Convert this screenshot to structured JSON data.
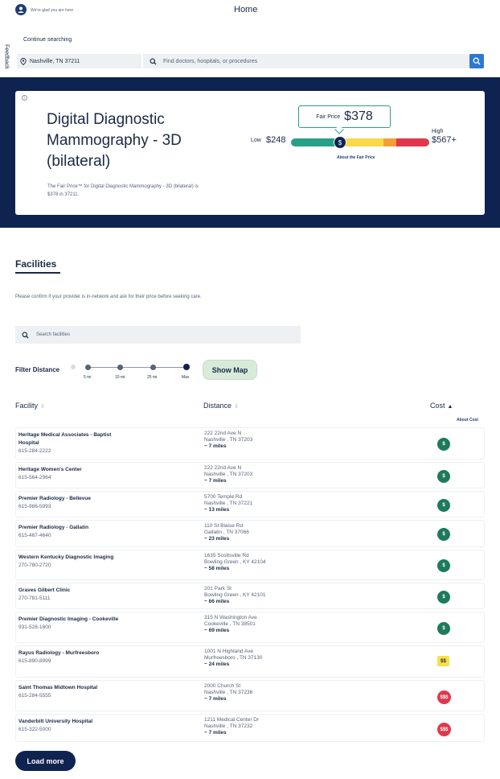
{
  "header": {
    "greeting": "We're glad you are here",
    "title": "Home",
    "continue_label": "Continue searching",
    "location_value": "Nashville, TN 37211",
    "search_placeholder": "Find doctors, hospitals, or procedures",
    "feedback_label": "Feedback"
  },
  "procedure": {
    "title": "Digital Diagnostic Mammography - 3D (bilateral)",
    "description": "The Fair Price™ for Digital Diagnostic Mammography - 3D (bilateral) is $378 in 37211.",
    "fair_price_label": "Fair Price",
    "fair_price_value": "$378",
    "low_label": "Low",
    "low_value": "$248",
    "high_label": "High",
    "high_value": "$567+",
    "marker_symbol": "$",
    "about_link": "About the Fair Price"
  },
  "facilities": {
    "heading": "Facilities",
    "note": "Please confirm if your provider is in-network and ask for their price before seeking care.",
    "search_placeholder": "Search facilities",
    "filter_label": "Filter Distance",
    "distance_options": [
      "5 mi",
      "10 mi",
      "25 mi",
      "Max"
    ],
    "distance_selected_index": 3,
    "show_map_label": "Show Map",
    "columns": {
      "facility": "Facility",
      "distance": "Distance",
      "cost": "Cost"
    },
    "about_cost": "About Cost",
    "rows": [
      {
        "name": "Heritage Medical Associates - Baptist Hospital",
        "phone": "615-284-2222",
        "addr1": "222 22nd Ave N",
        "addr2": "Nashville , TN 37203",
        "distance": "~ 7 miles",
        "cost": "$"
      },
      {
        "name": "Heritage Women's Center",
        "phone": "615-564-2964",
        "addr1": "222 22nd Ave N",
        "addr2": "Nashville , TN 37203",
        "distance": "~ 7 miles",
        "cost": "$"
      },
      {
        "name": "Premier Radiology - Bellevue",
        "phone": "615-986-5993",
        "addr1": "5700 Temple Rd",
        "addr2": "Nashville , TN 37221",
        "distance": "~ 13 miles",
        "cost": "$"
      },
      {
        "name": "Premier Radiology - Gallatin",
        "phone": "615-467-4640",
        "addr1": "110 St Blaise Rd",
        "addr2": "Gallatin , TN 37066",
        "distance": "~ 23 miles",
        "cost": "$"
      },
      {
        "name": "Western Kentucky Diagnostic Imaging",
        "phone": "270-780-2720",
        "addr1": "1635 Scottsville Rd",
        "addr2": "Bowling Green , KY 42104",
        "distance": "~ 58 miles",
        "cost": "$"
      },
      {
        "name": "Graves Gilbert Clinic",
        "phone": "270-781-5111",
        "addr1": "201 Park St",
        "addr2": "Bowling Green , KY 42101",
        "distance": "~ 66 miles",
        "cost": "$"
      },
      {
        "name": "Premier Diagnostic Imaging - Cookeville",
        "phone": "931-528-1800",
        "addr1": "315 N Washington Ave",
        "addr2": "Cookeville , TN 38501",
        "distance": "~ 69 miles",
        "cost": "$"
      },
      {
        "name": "Rayus Radiology - Murfreesboro",
        "phone": "615-890-8999",
        "addr1": "1001 N Highland Ave",
        "addr2": "Murfreesboro , TN 37130",
        "distance": "~ 24 miles",
        "cost": "$$"
      },
      {
        "name": "Saint Thomas Midtown Hospital",
        "phone": "615-284-5555",
        "addr1": "2000 Church St",
        "addr2": "Nashville , TN 37236",
        "distance": "~ 7 miles",
        "cost": "$$$"
      },
      {
        "name": "Vanderbilt University Hospital",
        "phone": "615-322-5000",
        "addr1": "1211 Medical Center Dr",
        "addr2": "Nashville , TN 37232",
        "distance": "~ 7 miles",
        "cost": "$$$"
      }
    ],
    "load_more": "Load more"
  },
  "colors": {
    "navy": "#0e2350",
    "accent_blue": "#2e78d1",
    "low_cost": "#1d7a5c",
    "mid_cost": "#f7e04a",
    "high_cost": "#e0384b"
  }
}
